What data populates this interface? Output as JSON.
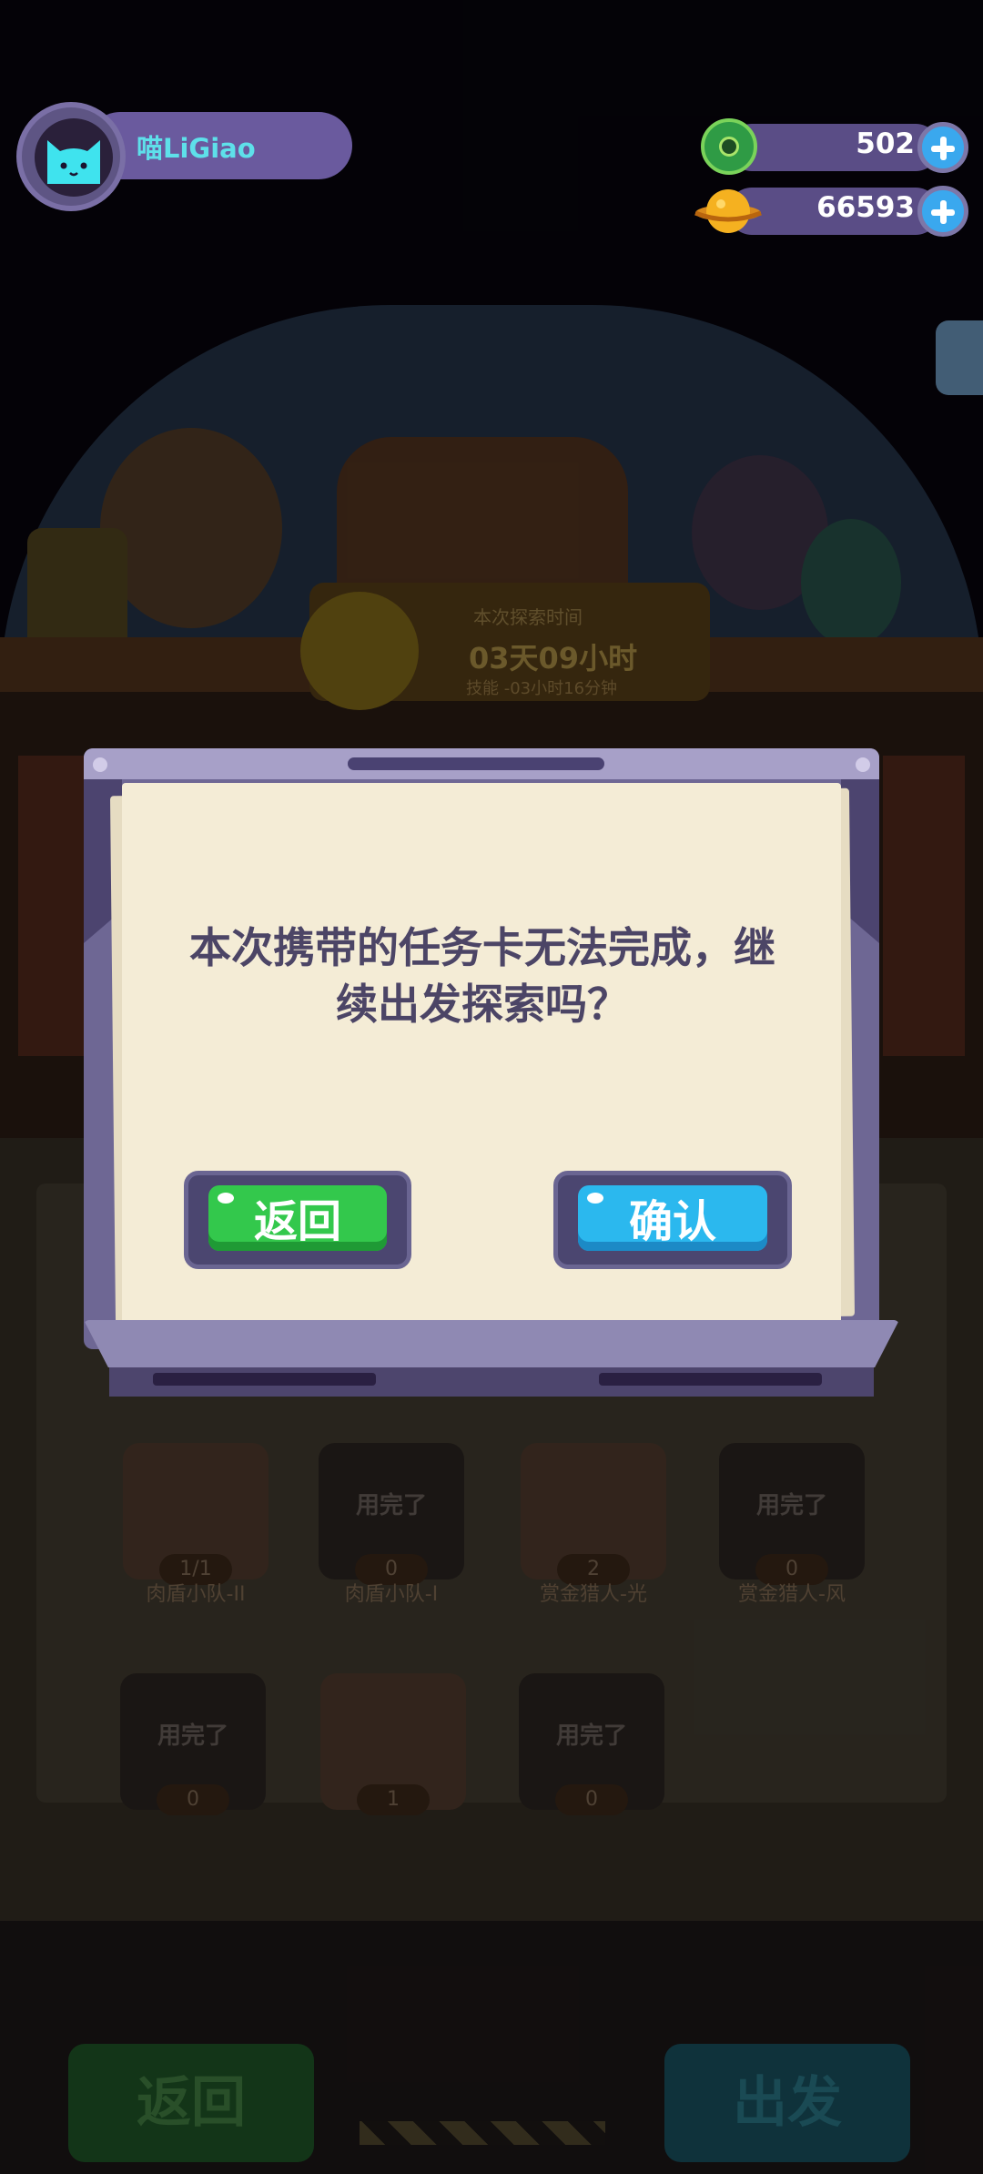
{
  "hud": {
    "player_name": "喵LiGiao",
    "gems": "502",
    "coins": "66593"
  },
  "background": {
    "timer_title": "本次探索时间",
    "timer_value": "03天09小时",
    "timer_sub": "技能 -03小时16分钟",
    "cards": [
      {
        "status": "",
        "count": "1/1",
        "name": "肉盾小队-II"
      },
      {
        "status": "用完了",
        "count": "0",
        "name": "肉盾小队-I"
      },
      {
        "status": "",
        "count": "2",
        "name": "赏金猎人-光"
      },
      {
        "status": "用完了",
        "count": "0",
        "name": "赏金猎人-风"
      },
      {
        "status": "用完了",
        "count": "0",
        "name": ""
      },
      {
        "status": "",
        "count": "1",
        "name": ""
      },
      {
        "status": "用完了",
        "count": "0",
        "name": ""
      }
    ],
    "back_label": "返回",
    "depart_label": "出发"
  },
  "dialog": {
    "message_line1": "本次携带的任务卡无法完成，继",
    "message_line2": "续出发探索吗？",
    "back_label": "返回",
    "confirm_label": "确认"
  },
  "colors": {
    "back_button": "#33c84c",
    "confirm_button": "#2bb8ee",
    "dialog_text": "#4c4566",
    "name_text": "#5ee0ea"
  },
  "icons": {
    "avatar": "cat-avatar-icon",
    "gems": "donut-gem-icon",
    "coins": "planet-coin-icon",
    "add": "plus-icon"
  }
}
